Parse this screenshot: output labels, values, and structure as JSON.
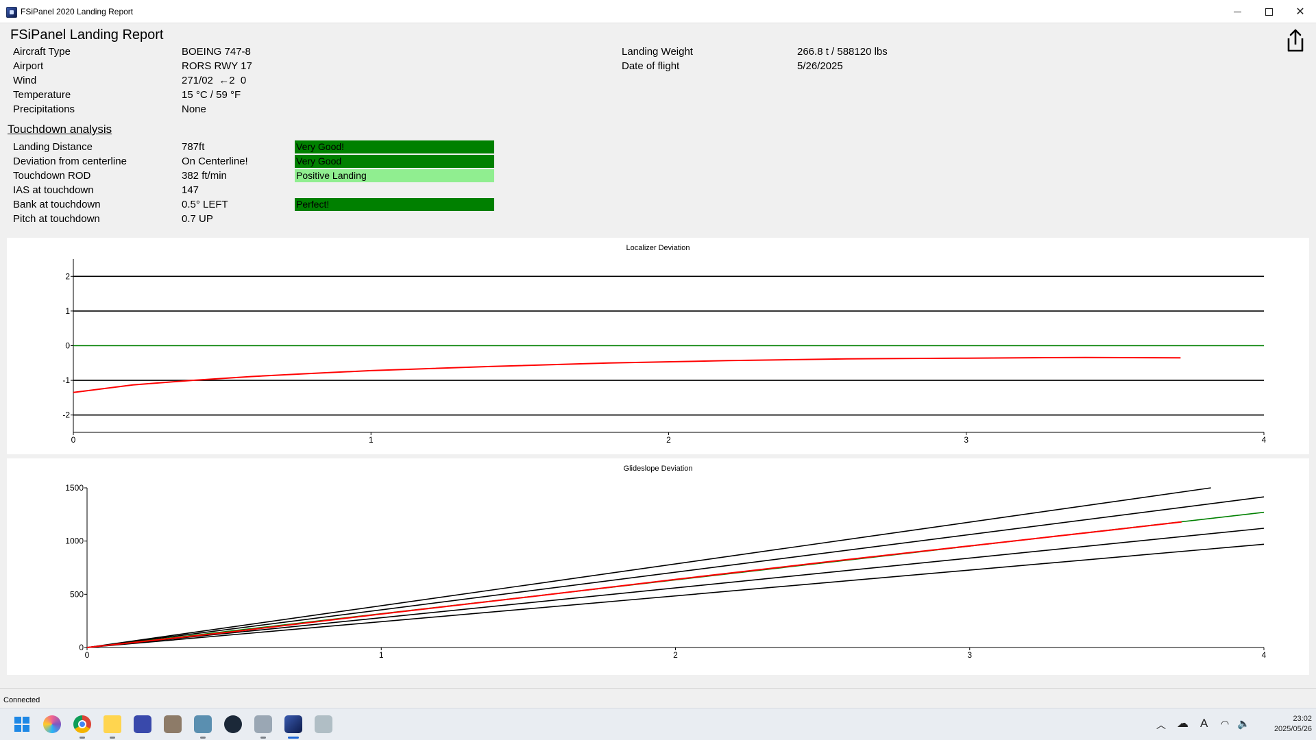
{
  "window": {
    "title": "FSiPanel 2020 Landing Report",
    "icon": "fsipanel-app-icon",
    "controls": [
      "minimize-icon",
      "maximize-icon",
      "close-icon"
    ]
  },
  "report": {
    "title": "FSiPanel Landing Report",
    "share_icon": "share-icon",
    "info_left": [
      {
        "label": "Aircraft Type",
        "value": "BOEING 747-8"
      },
      {
        "label": "Airport",
        "value": "RORS RWY 17"
      },
      {
        "label": "Wind",
        "value": "271/02  ←2  0"
      },
      {
        "label": "Temperature",
        "value": "15 °C / 59 °F"
      },
      {
        "label": "Precipitations",
        "value": "None"
      }
    ],
    "info_right": [
      {
        "label": "Landing Weight",
        "value": "266.8 t / 588120 lbs"
      },
      {
        "label": "Date of flight",
        "value": "5/26/2025"
      }
    ]
  },
  "touchdown": {
    "title": "Touchdown analysis",
    "rows": [
      {
        "label": "Landing Distance",
        "value": "787ft",
        "rating": "Very Good!",
        "rating_color": "#008000"
      },
      {
        "label": "Deviation from centerline",
        "value": "On Centerline!",
        "rating": "Very Good",
        "rating_color": "#008000"
      },
      {
        "label": "Touchdown ROD",
        "value": "382 ft/min",
        "rating": "Positive Landing",
        "rating_color": "#90ee90"
      },
      {
        "label": "IAS at touchdown",
        "value": "147",
        "rating": "",
        "rating_color": ""
      },
      {
        "label": "Bank at touchdown",
        "value": "0.5° LEFT",
        "rating": "Perfect!",
        "rating_color": "#008000"
      },
      {
        "label": "Pitch at touchdown",
        "value": "0.7 UP",
        "rating": "",
        "rating_color": ""
      }
    ]
  },
  "chart_data": [
    {
      "type": "line",
      "title": "Localizer Deviation",
      "xlabel": "",
      "ylabel": "",
      "xlim": [
        0,
        4
      ],
      "ylim": [
        -2.5,
        2.5
      ],
      "x_ticks": [
        0,
        1,
        2,
        3,
        4
      ],
      "y_ticks": [
        2,
        1,
        0,
        -1,
        -2
      ],
      "grid": true,
      "series": [
        {
          "color": "#000000",
          "x": [
            0,
            4
          ],
          "y": [
            2,
            2
          ]
        },
        {
          "color": "#000000",
          "x": [
            0,
            4
          ],
          "y": [
            1,
            1
          ]
        },
        {
          "color": "#008000",
          "x": [
            0,
            4
          ],
          "y": [
            0,
            0
          ]
        },
        {
          "color": "#000000",
          "x": [
            0,
            4
          ],
          "y": [
            -1,
            -1
          ]
        },
        {
          "color": "#000000",
          "x": [
            0,
            4
          ],
          "y": [
            -2,
            -2
          ]
        },
        {
          "color": "#ff0000",
          "x": [
            0,
            0.2,
            0.4,
            0.6,
            0.8,
            1.0,
            1.4,
            1.8,
            2.2,
            2.6,
            3.0,
            3.4,
            3.72
          ],
          "y": [
            -1.35,
            -1.13,
            -1.0,
            -0.89,
            -0.8,
            -0.72,
            -0.6,
            -0.5,
            -0.43,
            -0.38,
            -0.36,
            -0.34,
            -0.35
          ]
        }
      ]
    },
    {
      "type": "line",
      "title": "Glideslope Deviation",
      "xlabel": "",
      "ylabel": "",
      "xlim": [
        0,
        4
      ],
      "ylim": [
        0,
        1500
      ],
      "x_ticks": [
        0,
        1,
        2,
        3,
        4
      ],
      "y_ticks": [
        1500,
        1000,
        500,
        0
      ],
      "grid": false,
      "series": [
        {
          "color": "#000000",
          "x": [
            0,
            3.82
          ],
          "y": [
            0,
            1500
          ]
        },
        {
          "color": "#000000",
          "x": [
            0,
            4
          ],
          "y": [
            0,
            1415
          ]
        },
        {
          "color": "#008000",
          "x": [
            0,
            4
          ],
          "y": [
            0,
            1270
          ]
        },
        {
          "color": "#000000",
          "x": [
            0,
            4
          ],
          "y": [
            0,
            1120
          ]
        },
        {
          "color": "#000000",
          "x": [
            0,
            4
          ],
          "y": [
            0,
            970
          ]
        },
        {
          "color": "#ff0000",
          "x": [
            0,
            0.5,
            1.0,
            1.5,
            2.0,
            2.5,
            3.0,
            3.5,
            3.72
          ],
          "y": [
            0,
            150,
            315,
            475,
            640,
            800,
            955,
            1110,
            1180
          ]
        }
      ]
    }
  ],
  "status": {
    "text": "Connected"
  },
  "taskbar": {
    "icons": [
      "windows-start-icon",
      "copilot-icon",
      "chrome-icon",
      "file-explorer-icon",
      "flight-tool-icon",
      "gimp-icon",
      "airport-editor-icon",
      "steam-icon",
      "flight-sim-icon",
      "fsipanel-icon",
      "report-tool-icon"
    ],
    "tray": [
      "chevron-up-icon",
      "cloud-icon",
      "language-icon",
      "wifi-icon",
      "volume-icon"
    ],
    "language": "A",
    "time": "23:02",
    "date": "2025/05/26"
  }
}
